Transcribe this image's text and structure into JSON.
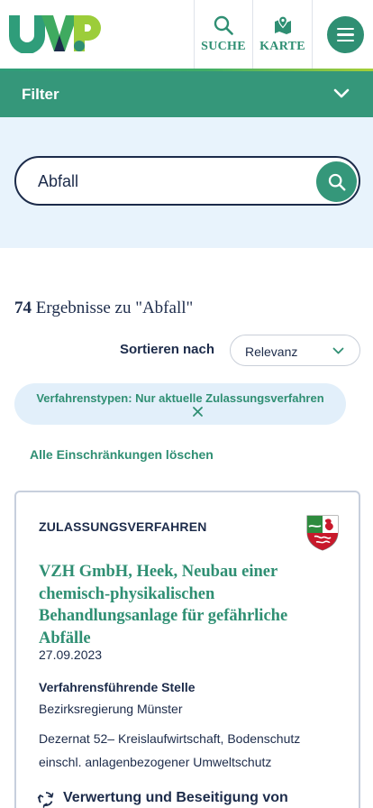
{
  "header": {
    "logo_text": "UVP",
    "search_label": "SUCHE",
    "map_label": "KARTE"
  },
  "filter": {
    "title": "Filter"
  },
  "search": {
    "value": "Abfall"
  },
  "results": {
    "count": "74",
    "label": "Ergebnisse zu \"Abfall\""
  },
  "sort": {
    "label": "Sortieren nach",
    "selected": "Relevanz"
  },
  "active_filter": {
    "label": "Verfahrenstypen: Nur aktuelle Zulassungsverfahren"
  },
  "clear_filters": "Alle Einschränkungen löschen",
  "card": {
    "type": "ZULASSUNGSVERFAHREN",
    "title": "VZH GmbH, Heek, Neubau einer chemisch-physikalischen Behandlungsanlage für gefährliche Abfälle",
    "date": "27.09.2023",
    "authority_heading": "Verfahrensführende Stelle",
    "authority_name": "Bezirksregierung Münster",
    "authority_department": "Dezernat 52– Kreislaufwirtschaft, Bodenschutz einschl. anlagenbezogener Umweltschutz",
    "category": "Verwertung und Beseitigung von"
  },
  "colors": {
    "primary_green": "#35977a",
    "navy": "#1c2b4a",
    "light_blue": "#e8f3fc"
  },
  "icons": {
    "search": "search-icon",
    "map": "map-icon",
    "menu": "hamburger-menu-icon",
    "filter_toggle": "chevron-down-icon",
    "remove_filter": "close-icon",
    "state_emblem": "nrw-coat-of-arms-icon",
    "category": "recycling-icon"
  }
}
